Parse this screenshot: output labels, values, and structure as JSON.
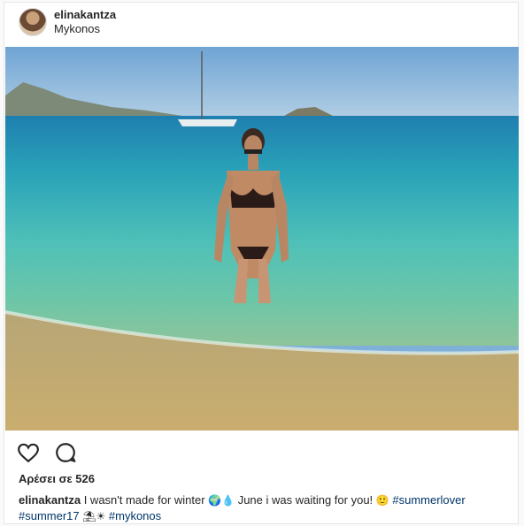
{
  "post": {
    "username": "elinakantza",
    "location": "Mykonos",
    "likes_text": "Αρέσει σε 526",
    "caption": {
      "username": "elinakantza",
      "text_part1": " I wasn't made for winter ",
      "emoji1": "🌍💧",
      "text_part2": " June i was waiting for you! ",
      "emoji2": "🙂",
      "tag1": "#summerlover",
      "tag2": "#summer17",
      "emoji3": "⛱☀",
      "tag3": "#mykonos"
    }
  },
  "icons": {
    "like": "heart-icon",
    "comment": "comment-icon"
  },
  "colors": {
    "hashtag": "#003569",
    "text": "#262626",
    "border": "#e6e6e6"
  }
}
